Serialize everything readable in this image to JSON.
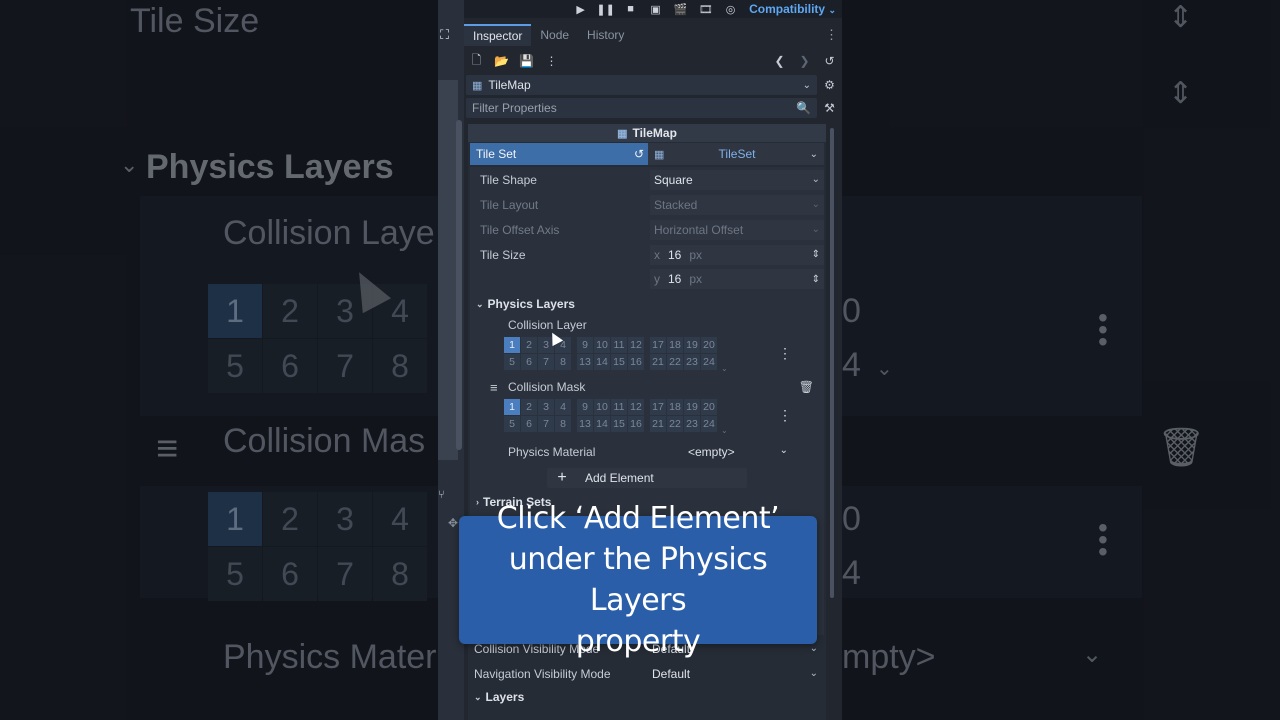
{
  "toolbar": {
    "renderer": "Compatibility"
  },
  "dock_tabs": [
    "Inspector",
    "Node",
    "History"
  ],
  "inspector": {
    "object_name": "TileMap",
    "filter_placeholder": "Filter Properties",
    "class_header": "TileMap",
    "tile_set": {
      "label": "Tile Set",
      "value": "TileSet"
    },
    "tile_shape": {
      "label": "Tile Shape",
      "value": "Square"
    },
    "tile_layout": {
      "label": "Tile Layout",
      "value": "Stacked"
    },
    "tile_offset_axis": {
      "label": "Tile Offset Axis",
      "value": "Horizontal Offset"
    },
    "tile_size": {
      "label": "Tile Size",
      "x_axis": "x",
      "x": "16",
      "y_axis": "y",
      "y": "16",
      "unit": "px"
    },
    "physics_layers": {
      "label": "Physics Layers",
      "collision_layer": {
        "label": "Collision Layer",
        "row1": [
          "1",
          "2",
          "3",
          "4",
          "9",
          "10",
          "11",
          "12",
          "17",
          "18",
          "19",
          "20"
        ],
        "row2": [
          "5",
          "6",
          "7",
          "8",
          "13",
          "14",
          "15",
          "16",
          "21",
          "22",
          "23",
          "24"
        ]
      },
      "collision_mask": {
        "label": "Collision Mask",
        "row1": [
          "1",
          "2",
          "3",
          "4",
          "9",
          "10",
          "11",
          "12",
          "17",
          "18",
          "19",
          "20"
        ],
        "row2": [
          "5",
          "6",
          "7",
          "8",
          "13",
          "14",
          "15",
          "16",
          "21",
          "22",
          "23",
          "24"
        ]
      },
      "physics_material": {
        "label": "Physics Material",
        "value": "<empty>"
      },
      "add_element": "Add Element"
    },
    "terrain_sets": "Terrain Sets",
    "collision_visibility": {
      "label": "Collision Visibility Mode",
      "value": "Default"
    },
    "navigation_visibility": {
      "label": "Navigation Visibility Mode",
      "value": "Default"
    },
    "layers": "Layers"
  },
  "background": {
    "tile_size": "Tile Size",
    "physics_layers": "Physics Layers",
    "collision_layer": "Collision Laye",
    "collision_mask": "Collision Mas",
    "physics_material": "Physics Mater",
    "empty": "mpty>",
    "grid_top": [
      "1",
      "2",
      "3",
      "4"
    ],
    "grid_bottom": [
      "5",
      "6",
      "7",
      "8"
    ],
    "right_top": "0",
    "right_bottom": "4"
  },
  "caption": {
    "line1": "Click ‘Add Element’",
    "line2": "under the Physics Layers",
    "line3": "property"
  }
}
